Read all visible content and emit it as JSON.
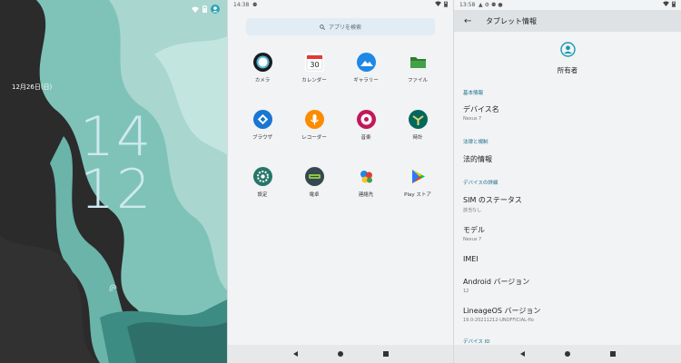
{
  "lockscreen": {
    "date": "12月26日(日)",
    "hours": "14",
    "minutes": "12"
  },
  "drawer": {
    "status_time": "14:38",
    "search_placeholder": "アプリを検索",
    "apps": [
      {
        "label": "カメラ",
        "icon": "camera-icon"
      },
      {
        "label": "カレンダー",
        "icon": "calendar-icon",
        "badge": "30"
      },
      {
        "label": "ギャラリー",
        "icon": "gallery-icon"
      },
      {
        "label": "ファイル",
        "icon": "files-icon"
      },
      {
        "label": "ブラウザ",
        "icon": "browser-icon"
      },
      {
        "label": "レコーダー",
        "icon": "recorder-icon"
      },
      {
        "label": "音楽",
        "icon": "music-icon"
      },
      {
        "label": "時計",
        "icon": "clock-icon"
      },
      {
        "label": "設定",
        "icon": "settings-icon"
      },
      {
        "label": "電卓",
        "icon": "calculator-icon"
      },
      {
        "label": "連絡先",
        "icon": "contacts-icon"
      },
      {
        "label": "Play ストア",
        "icon": "play-store-icon"
      }
    ]
  },
  "settings": {
    "status_time": "13:58",
    "title": "タブレット情報",
    "owner_label": "所有者",
    "sections": {
      "basic": "基本情報",
      "legal": "法律と規制",
      "details": "デバイスの詳細",
      "device_id": "デバイス ID"
    },
    "device_name": {
      "title": "デバイス名",
      "value": "Nexus 7"
    },
    "legal_info": {
      "title": "法的情報"
    },
    "sim_status": {
      "title": "SIM のステータス",
      "value": "該当なし"
    },
    "model": {
      "title": "モデル",
      "value": "Nexus 7"
    },
    "imei": {
      "title": "IMEI"
    },
    "android_version": {
      "title": "Android バージョン",
      "value": "12"
    },
    "lineage_version": {
      "title": "LineageOS バージョン",
      "value": "19.0-20211212-UNOFFICIAL-flo"
    }
  },
  "colors": {
    "accent": "#1a9ab0",
    "lock_clock": "#cfe9f0",
    "section": "#1a6c87"
  }
}
